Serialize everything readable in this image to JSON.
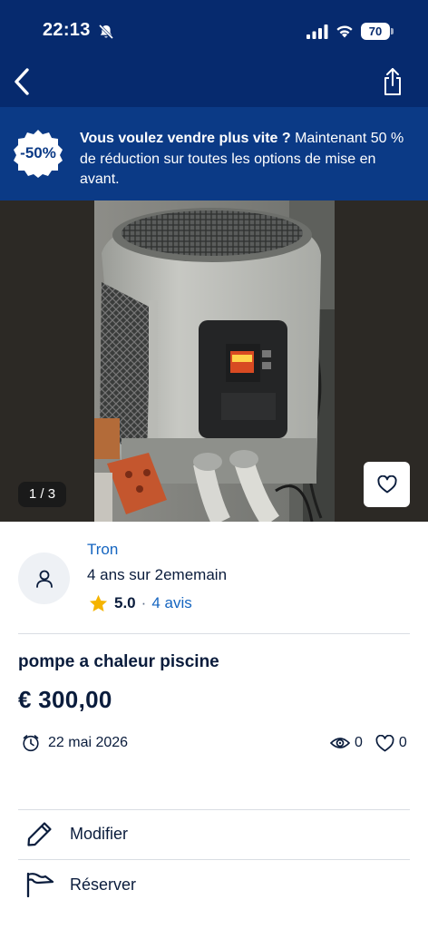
{
  "status_bar": {
    "time": "22:13",
    "battery": "70",
    "icons": [
      "bell-slash-icon",
      "signal-icon",
      "wifi-icon",
      "battery-icon"
    ]
  },
  "nav": {
    "back_icon": "chevron-left-icon",
    "share_icon": "share-icon"
  },
  "promo": {
    "badge": "-50%",
    "text_bold": "Vous voulez vendre plus vite ?",
    "text": " Maintenant 50 % de réduction sur toutes les options de mise en avant."
  },
  "photo": {
    "counter": "1 / 3",
    "favorite_icon": "heart-outline-icon"
  },
  "seller": {
    "name": "Tron",
    "since": "4 ans sur 2ememain",
    "rating": "5.0",
    "separator": "·",
    "reviews": "4 avis"
  },
  "listing": {
    "title": "pompe a chaleur piscine",
    "price": "€ 300,00",
    "date": "22 mai 2026",
    "views": "0",
    "favorites": "0"
  },
  "actions": [
    {
      "label": "Modifier",
      "icon": "pencil-icon"
    },
    {
      "label": "Réserver",
      "icon": "flag-icon"
    }
  ],
  "colors": {
    "header": "#062a6e",
    "promo": "#0b3a86",
    "link": "#1565c0",
    "text": "#0a1c3c",
    "star": "#f5b400"
  }
}
